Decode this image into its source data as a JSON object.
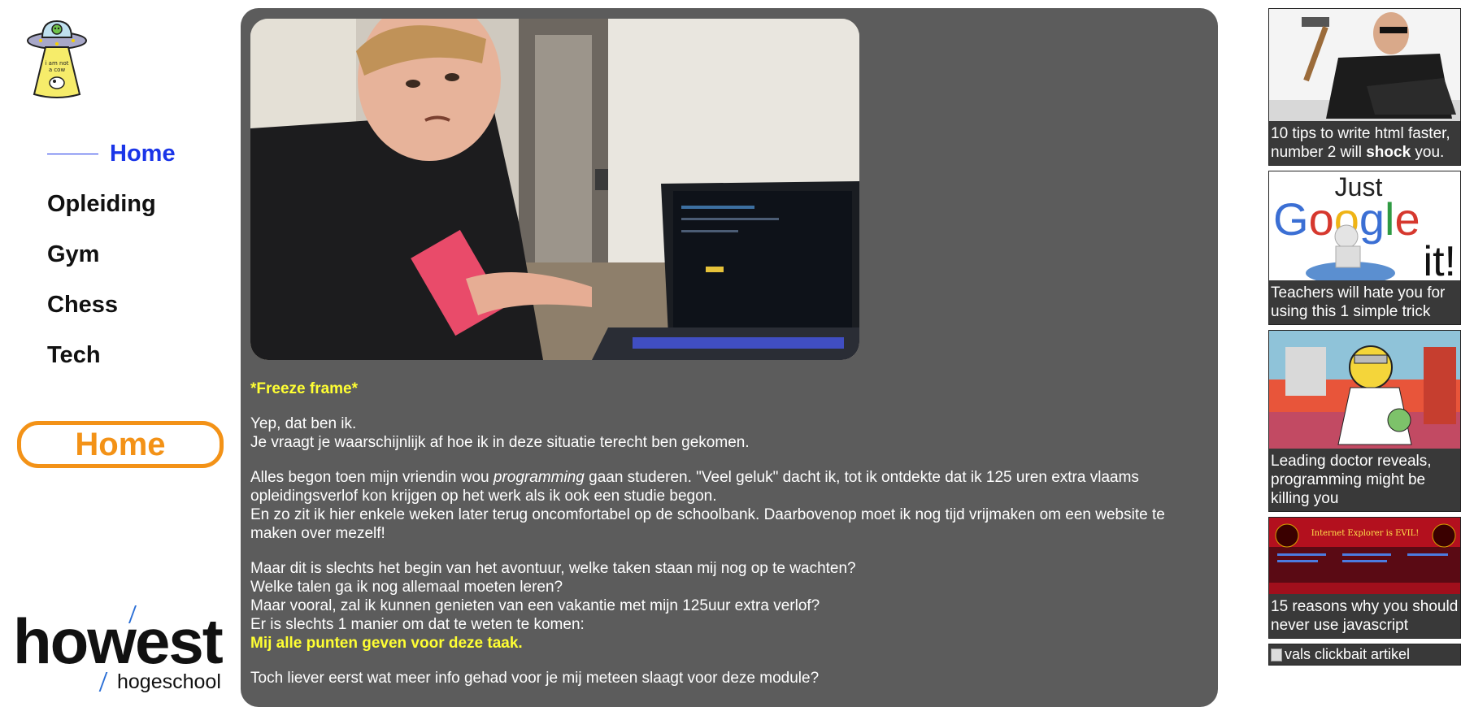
{
  "sidebar": {
    "logo_text": "i am not a cow",
    "nav": [
      {
        "label": "Home",
        "active": true
      },
      {
        "label": "Opleiding",
        "active": false
      },
      {
        "label": "Gym",
        "active": false
      },
      {
        "label": "Chess",
        "active": false
      },
      {
        "label": "Tech",
        "active": false
      }
    ],
    "home_button": "Home",
    "brand": {
      "name": "howest",
      "sub": "hogeschool"
    }
  },
  "main": {
    "heading": "*Freeze frame*",
    "p1_l1": "Yep, dat ben ik.",
    "p1_l2": "Je vraagt je waarschijnlijk af hoe ik in deze situatie terecht ben gekomen.",
    "p2_a": "Alles begon toen mijn vriendin wou ",
    "p2_em": "programming",
    "p2_b": " gaan studeren. \"Veel geluk\" dacht ik, tot ik ontdekte dat ik 125 uren extra vlaams opleidingsverlof kon krijgen op het werk als ik ook een studie begon.",
    "p2_l2": "En zo zit ik hier enkele weken later terug oncomfortabel op de schoolbank. Daarbovenop moet ik nog tijd vrijmaken om een website te maken over mezelf!",
    "p3_l1": "Maar dit is slechts het begin van het avontuur, welke taken staan mij nog op te wachten?",
    "p3_l2": "Welke talen ga ik nog allemaal moeten leren?",
    "p3_l3": "Maar vooral, zal ik kunnen genieten van een vakantie met mijn 125uur extra verlof?",
    "p3_l4": "Er is slechts 1 manier om dat te weten te komen:",
    "p3_highlight": "Mij alle punten geven voor deze taak.",
    "p4": "Toch liever eerst wat meer info gehad voor je mij meteen slaagt voor deze module?"
  },
  "ads": {
    "ad1_a": "10 tips to write html faster, number 2 will ",
    "ad1_b": "shock",
    "ad1_c": " you.",
    "ad2": "Teachers will hate you for using this 1 simple trick",
    "ad2_img_text": "Just Google it!",
    "ad3": "Leading doctor reveals, programming might be killing you",
    "ad4": "15 reasons why you should never use javascript",
    "ad4_img_text": "Internet Explorer is EVIL!",
    "broken_alt": "vals clickbait artikel"
  },
  "colors": {
    "active": "#1a35e8",
    "accent": "#f39217",
    "card": "#5c5c5c",
    "highlight": "#ffff33"
  }
}
